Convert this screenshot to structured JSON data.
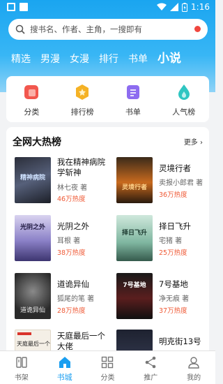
{
  "status_bar": {
    "time": "1:16"
  },
  "search": {
    "placeholder": "搜书名、作者、主角，一搜即有"
  },
  "tabs": [
    {
      "label": "精选"
    },
    {
      "label": "男漫"
    },
    {
      "label": "女漫"
    },
    {
      "label": "排行"
    },
    {
      "label": "书单"
    },
    {
      "label": "小说"
    }
  ],
  "shortcuts": [
    {
      "label": "分类",
      "icon": "category-icon",
      "color": "#f2574e"
    },
    {
      "label": "排行榜",
      "icon": "ranking-icon",
      "color": "#f5b225"
    },
    {
      "label": "书单",
      "icon": "booklist-icon",
      "color": "#8d6cf0"
    },
    {
      "label": "人气榜",
      "icon": "popularity-icon",
      "color": "#2fc6c2"
    }
  ],
  "ranking": {
    "title": "全网大热榜",
    "more": "更多",
    "books": [
      {
        "title": "我在精神病院学斩神",
        "author": "林七夜 著",
        "heat": "46万热度",
        "cover_text": "精神病院"
      },
      {
        "title": "灵境行者",
        "author": "卖报小郎君 著",
        "heat": "36万热度",
        "cover_text": "灵境行者"
      },
      {
        "title": "光阴之外",
        "author": "耳根 著",
        "heat": "38万热度",
        "cover_text": "光阴之外"
      },
      {
        "title": "择日飞升",
        "author": "宅猪 著",
        "heat": "25万热度",
        "cover_text": "择日飞升"
      },
      {
        "title": "道诡异仙",
        "author": "狐尾的笔 著",
        "heat": "28万热度",
        "cover_text": "道诡异仙"
      },
      {
        "title": "7号基地",
        "author": "净无痕 著",
        "heat": "37万热度",
        "cover_text": "7号基地"
      },
      {
        "title": "天庭最后一个大佬",
        "author": "",
        "heat": "",
        "cover_text": "天庭最后一个"
      },
      {
        "title": "明克街13号",
        "author": "",
        "heat": "",
        "cover_text": ""
      }
    ]
  },
  "bottom_nav": [
    {
      "label": "书架",
      "icon": "bookshelf-icon"
    },
    {
      "label": "书城",
      "icon": "bookstore-icon",
      "active": true
    },
    {
      "label": "分类",
      "icon": "grid-icon"
    },
    {
      "label": "推广",
      "icon": "share-icon"
    },
    {
      "label": "我的",
      "icon": "user-icon"
    }
  ]
}
